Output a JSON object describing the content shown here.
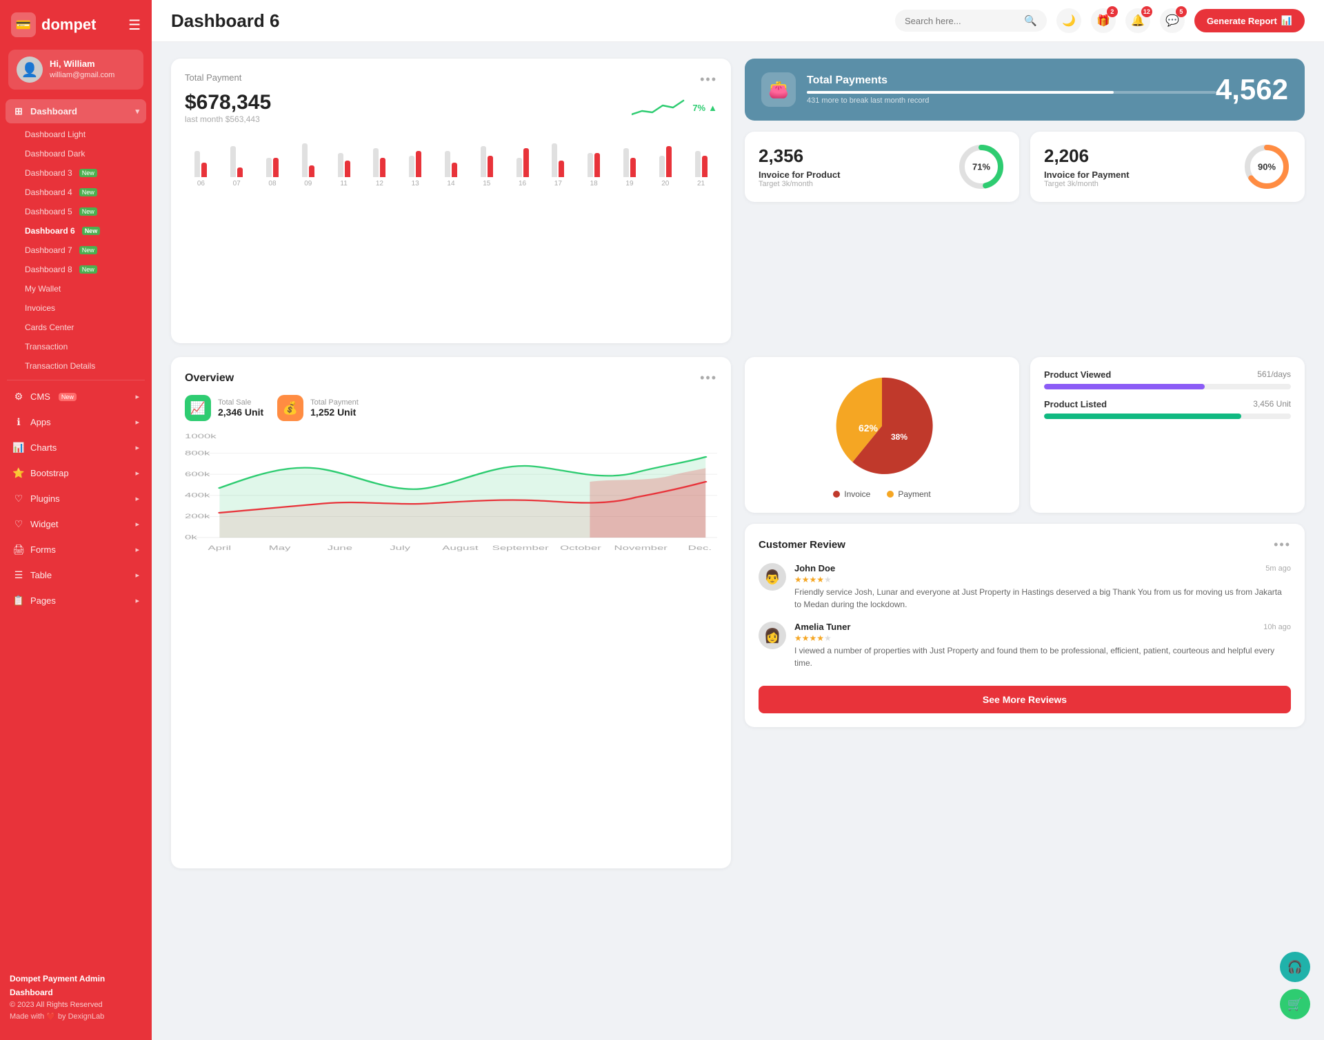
{
  "sidebar": {
    "logo": "dompet",
    "logo_icon": "💳",
    "user": {
      "name": "Hi, William",
      "email": "william@gmail.com",
      "avatar": "👤"
    },
    "nav_main": "Dashboard",
    "nav_items": [
      {
        "label": "Dashboard Light",
        "id": "dashboard-light"
      },
      {
        "label": "Dashboard Dark",
        "id": "dashboard-dark"
      },
      {
        "label": "Dashboard 3",
        "id": "dashboard-3",
        "badge": "New"
      },
      {
        "label": "Dashboard 4",
        "id": "dashboard-4",
        "badge": "New"
      },
      {
        "label": "Dashboard 5",
        "id": "dashboard-5",
        "badge": "New"
      },
      {
        "label": "Dashboard 6",
        "id": "dashboard-6",
        "badge": "New",
        "active": true
      },
      {
        "label": "Dashboard 7",
        "id": "dashboard-7",
        "badge": "New"
      },
      {
        "label": "Dashboard 8",
        "id": "dashboard-8",
        "badge": "New"
      },
      {
        "label": "My Wallet",
        "id": "my-wallet"
      },
      {
        "label": "Invoices",
        "id": "invoices"
      },
      {
        "label": "Cards Center",
        "id": "cards-center"
      },
      {
        "label": "Transaction",
        "id": "transaction"
      },
      {
        "label": "Transaction Details",
        "id": "transaction-details"
      }
    ],
    "nav_sections": [
      {
        "label": "CMS",
        "badge": "New",
        "icon": "⚙️",
        "arrow": true
      },
      {
        "label": "Apps",
        "icon": "ℹ️",
        "arrow": true
      },
      {
        "label": "Charts",
        "icon": "📊",
        "arrow": true
      },
      {
        "label": "Bootstrap",
        "icon": "⭐",
        "arrow": true
      },
      {
        "label": "Plugins",
        "icon": "❤️",
        "arrow": true
      },
      {
        "label": "Widget",
        "icon": "❤️",
        "arrow": true
      },
      {
        "label": "Forms",
        "icon": "🖨️",
        "arrow": true
      },
      {
        "label": "Table",
        "icon": "☰",
        "arrow": true
      },
      {
        "label": "Pages",
        "icon": "📋",
        "arrow": true
      }
    ],
    "footer": {
      "brand": "Dompet Payment Admin Dashboard",
      "copyright": "© 2023 All Rights Reserved",
      "made_by": "Made with ❤️ by DexignLab"
    }
  },
  "topbar": {
    "title": "Dashboard 6",
    "search_placeholder": "Search here...",
    "notifications": [
      {
        "id": "gift",
        "count": 2
      },
      {
        "id": "bell",
        "count": 12
      },
      {
        "id": "message",
        "count": 5
      }
    ],
    "generate_btn": "Generate Report"
  },
  "total_payment": {
    "title": "Total Payment",
    "amount": "$678,345",
    "last_month_label": "last month $563,443",
    "trend": "7%",
    "bars": [
      {
        "label": "06",
        "grey": 55,
        "red": 30
      },
      {
        "label": "07",
        "grey": 65,
        "red": 20
      },
      {
        "label": "08",
        "grey": 40,
        "red": 40
      },
      {
        "label": "09",
        "grey": 70,
        "red": 25
      },
      {
        "label": "11",
        "grey": 50,
        "red": 35
      },
      {
        "label": "12",
        "grey": 60,
        "red": 40
      },
      {
        "label": "13",
        "grey": 45,
        "red": 55
      },
      {
        "label": "14",
        "grey": 55,
        "red": 30
      },
      {
        "label": "15",
        "grey": 65,
        "red": 45
      },
      {
        "label": "16",
        "grey": 40,
        "red": 60
      },
      {
        "label": "17",
        "grey": 70,
        "red": 35
      },
      {
        "label": "18",
        "grey": 50,
        "red": 50
      },
      {
        "label": "19",
        "grey": 60,
        "red": 40
      },
      {
        "label": "20",
        "grey": 45,
        "red": 65
      },
      {
        "label": "21",
        "grey": 55,
        "red": 45
      }
    ]
  },
  "total_payments_banner": {
    "title": "Total Payments",
    "sub": "431 more to break last month record",
    "value": "4,562",
    "progress_pct": 75,
    "icon": "👛"
  },
  "invoice_product": {
    "value": "2,356",
    "label": "Invoice for Product",
    "target": "Target 3k/month",
    "pct": 71,
    "color": "#2ecc71"
  },
  "invoice_payment": {
    "value": "2,206",
    "label": "Invoice for Payment",
    "target": "Target 3k/month",
    "pct": 90,
    "color": "#ff8c42"
  },
  "overview": {
    "title": "Overview",
    "total_sale_label": "Total Sale",
    "total_sale_value": "2,346 Unit",
    "total_payment_label": "Total Payment",
    "total_payment_value": "1,252 Unit",
    "x_labels": [
      "April",
      "May",
      "June",
      "July",
      "August",
      "September",
      "October",
      "November",
      "Dec."
    ],
    "y_labels": [
      "0k",
      "200k",
      "400k",
      "600k",
      "800k",
      "1000k"
    ]
  },
  "pie_chart": {
    "invoice_pct": 62,
    "payment_pct": 38,
    "invoice_label": "Invoice",
    "payment_label": "Payment",
    "invoice_color": "#c0392b",
    "payment_color": "#f5a623"
  },
  "progress": {
    "items": [
      {
        "label": "Product Viewed",
        "value": "561/days",
        "pct": 65,
        "color": "#8b5cf6"
      },
      {
        "label": "Product Listed",
        "value": "3,456 Unit",
        "pct": 80,
        "color": "#10b981"
      }
    ]
  },
  "reviews": {
    "title": "Customer Review",
    "items": [
      {
        "name": "John Doe",
        "time": "5m ago",
        "stars": 4,
        "text": "Friendly service Josh, Lunar and everyone at Just Property in Hastings deserved a big Thank You from us for moving us from Jakarta to Medan during the lockdown.",
        "avatar": "👨"
      },
      {
        "name": "Amelia Tuner",
        "time": "10h ago",
        "stars": 4,
        "text": "I viewed a number of properties with Just Property and found them to be professional, efficient, patient, courteous and helpful every time.",
        "avatar": "👩"
      }
    ],
    "see_more_btn": "See More Reviews"
  },
  "colors": {
    "brand": "#e8333a",
    "sidebar_bg": "#e8333a",
    "banner_bg": "#5b8fa8"
  }
}
